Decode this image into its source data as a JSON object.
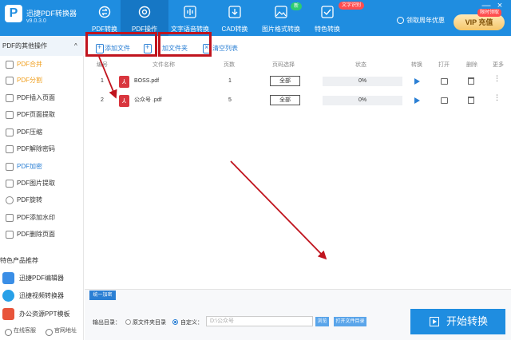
{
  "app": {
    "title": "迅捷PDF转换器",
    "version": "v9.0.3.0"
  },
  "nav": [
    {
      "label": "PDF转换",
      "icon": "convert-icon"
    },
    {
      "label": "PDF操作",
      "icon": "settings-icon"
    },
    {
      "label": "文字语音转换",
      "icon": "waveform-icon"
    },
    {
      "label": "CAD转换",
      "icon": "cad-icon"
    },
    {
      "label": "图片格式转换",
      "icon": "image-icon"
    },
    {
      "label": "特色转换",
      "icon": "special-icon"
    }
  ],
  "badges": {
    "new": "新",
    "ocr": "文字识别"
  },
  "header": {
    "promo": "领取周年优惠",
    "vip": "VIP 充值",
    "vip_badge": "限时领取"
  },
  "window": {
    "minimize": "—",
    "close": "×"
  },
  "sidebar": {
    "header": "PDF的其他操作",
    "collapse": "^",
    "items": [
      "PDF合并",
      "PDF分割",
      "PDF插入页面",
      "PDF页面提取",
      "PDF压缩",
      "PDF解除密码",
      "PDF加密",
      "PDF图片提取",
      "PDF旋转",
      "PDF添加水印",
      "PDF删除页面"
    ],
    "recommend_title": "特色产品推荐",
    "recommend": [
      "迅捷PDF编辑器",
      "迅捷视频转换器",
      "办公资源PPT模板"
    ],
    "footer": {
      "service": "在线客服",
      "site": "官网地址"
    }
  },
  "toolbar": {
    "add_file": "添加文件",
    "add_folder": "加文件夹",
    "clear_list": "清空列表"
  },
  "table": {
    "headers": {
      "num": "编号",
      "name": "文件名称",
      "pages": "页数",
      "range": "页码选择",
      "status": "状态",
      "convert": "转换",
      "open": "打开",
      "delete": "删除",
      "more": "更多"
    },
    "rows": [
      {
        "num": "1",
        "name": "BOSS.pdf",
        "pages": "1",
        "range": "全部",
        "progress": "0%"
      },
      {
        "num": "2",
        "name": "公众号  .pdf",
        "pages": "5",
        "range": "全部",
        "progress": "0%"
      }
    ]
  },
  "bottom": {
    "unify": "统一加密",
    "output_label": "输出目录：",
    "original_dir": "原文件夹目录",
    "custom": "自定义：",
    "path": "D:\\公众号",
    "browse": "浏览",
    "open_folder": "打开文件目录",
    "start": "开始转换"
  },
  "colors": {
    "primary": "#1f8de0",
    "highlight": "#c0141e",
    "active_item": "#f0a020"
  }
}
